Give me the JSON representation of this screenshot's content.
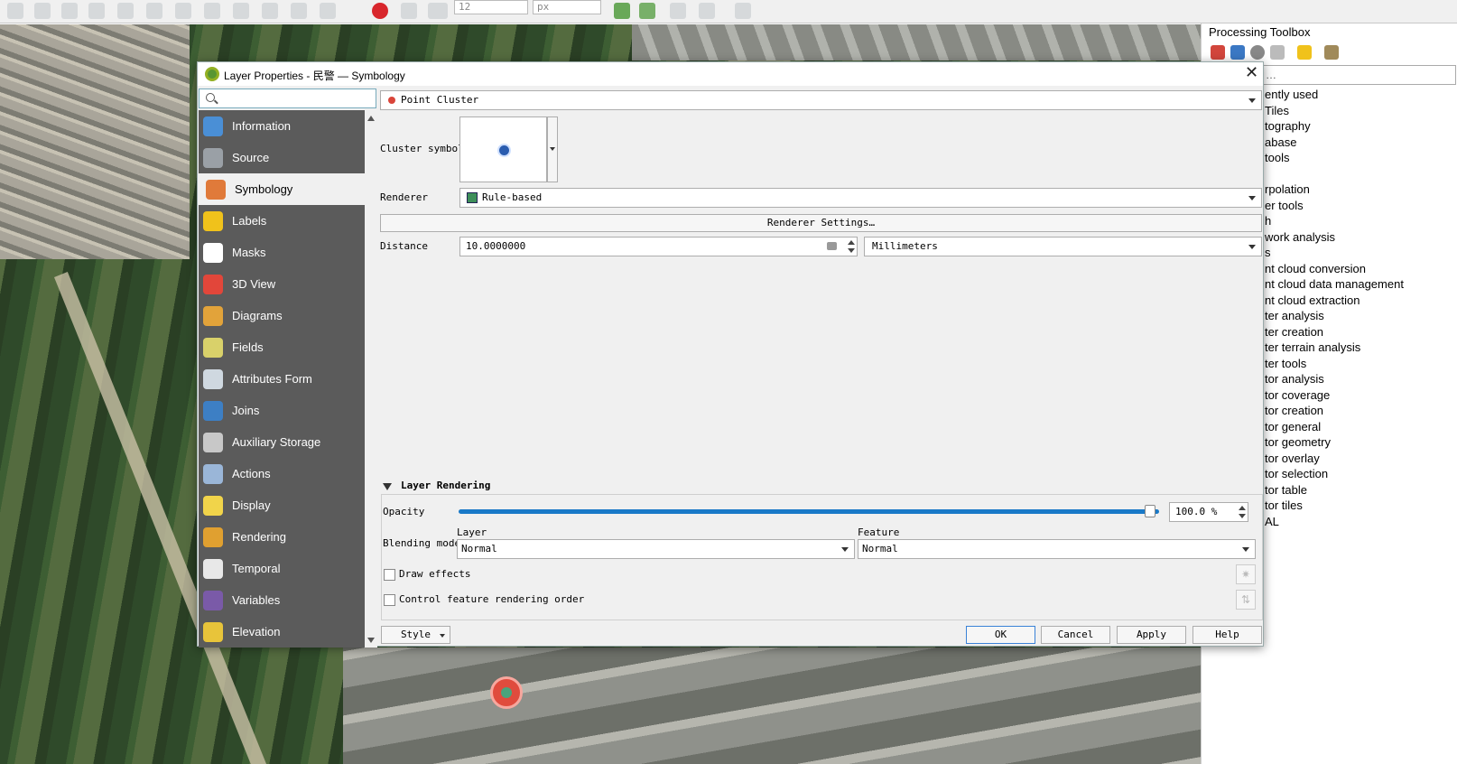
{
  "toolbar": {
    "font_size_value": "12",
    "unit_value": "px"
  },
  "toolbox": {
    "title": "Processing Toolbox",
    "search_placeholder": "…",
    "items": [
      "ently used",
      "Tiles",
      "tography",
      "abase",
      "tools",
      "",
      "rpolation",
      "er tools",
      "h",
      "work analysis",
      "s",
      "nt cloud conversion",
      "nt cloud data management",
      "nt cloud extraction",
      "ter analysis",
      "ter creation",
      "ter terrain analysis",
      "ter tools",
      "tor analysis",
      "tor coverage",
      "tor creation",
      "tor general",
      "tor geometry",
      "tor overlay",
      "tor selection",
      "tor table",
      "tor tiles",
      "AL"
    ]
  },
  "dialog": {
    "title": "Layer Properties - 民警 — Symbology",
    "close_glyph": "✕",
    "sidebar": [
      {
        "label": "Information",
        "icon": "information-icon",
        "color": "#4a8fd6"
      },
      {
        "label": "Source",
        "icon": "source-icon",
        "color": "#9aa0a6"
      },
      {
        "label": "Symbology",
        "icon": "symbology-icon",
        "color": "#e07a3a",
        "active": true
      },
      {
        "label": "Labels",
        "icon": "labels-icon",
        "color": "#f0c21b"
      },
      {
        "label": "Masks",
        "icon": "masks-icon",
        "color": "#ffffff"
      },
      {
        "label": "3D View",
        "icon": "3d-view-icon",
        "color": "#e2463a"
      },
      {
        "label": "Diagrams",
        "icon": "diagrams-icon",
        "color": "#e2a33a"
      },
      {
        "label": "Fields",
        "icon": "fields-icon",
        "color": "#d9d16a"
      },
      {
        "label": "Attributes Form",
        "icon": "attributes-form-icon",
        "color": "#cfd8e0"
      },
      {
        "label": "Joins",
        "icon": "joins-icon",
        "color": "#3d7fc4"
      },
      {
        "label": "Auxiliary Storage",
        "icon": "auxiliary-storage-icon",
        "color": "#c8c8c8"
      },
      {
        "label": "Actions",
        "icon": "actions-icon",
        "color": "#9ab6d8"
      },
      {
        "label": "Display",
        "icon": "display-icon",
        "color": "#f1d44a"
      },
      {
        "label": "Rendering",
        "icon": "rendering-icon",
        "color": "#e0a030"
      },
      {
        "label": "Temporal",
        "icon": "temporal-icon",
        "color": "#e8e8e8"
      },
      {
        "label": "Variables",
        "icon": "variables-icon",
        "color": "#7a5aa8"
      },
      {
        "label": "Elevation",
        "icon": "elevation-icon",
        "color": "#e8c43a"
      }
    ],
    "renderer_type": "Point Cluster",
    "cluster_symbol_label": "Cluster symbol",
    "renderer_label": "Renderer",
    "renderer_value": "Rule-based",
    "renderer_settings_button": "Renderer Settings…",
    "distance_label": "Distance",
    "distance_value": "10.0000000",
    "distance_unit": "Millimeters",
    "layer_rendering": {
      "header": "Layer Rendering",
      "opacity_label": "Opacity",
      "opacity_value": "100.0 %",
      "opacity_fraction": 1.0,
      "blending_label": "Blending mode",
      "layer_label": "Layer",
      "layer_value": "Normal",
      "feature_label": "Feature",
      "feature_value": "Normal",
      "draw_effects_label": "Draw effects",
      "control_order_label": "Control feature rendering order"
    },
    "buttons": {
      "style": "Style",
      "ok": "OK",
      "cancel": "Cancel",
      "apply": "Apply",
      "help": "Help"
    }
  }
}
